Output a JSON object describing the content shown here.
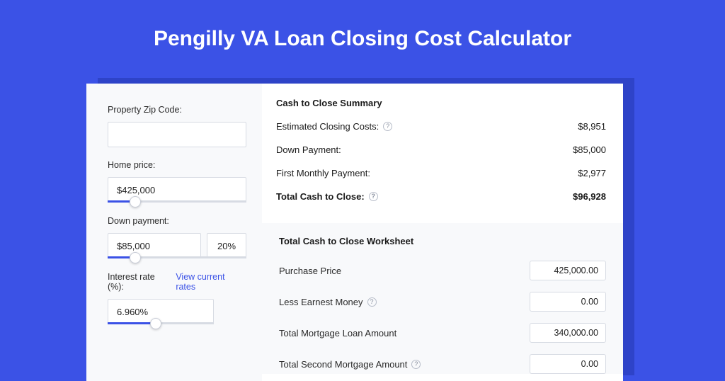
{
  "page": {
    "title": "Pengilly VA Loan Closing Cost Calculator"
  },
  "left": {
    "zip": {
      "label": "Property Zip Code:",
      "value": ""
    },
    "home_price": {
      "label": "Home price:",
      "value": "$425,000"
    },
    "down_payment": {
      "label": "Down payment:",
      "value": "$85,000",
      "pct": "20%"
    },
    "interest": {
      "label": "Interest rate (%):",
      "link": "View current rates",
      "value": "6.960%"
    }
  },
  "summary": {
    "title": "Cash to Close Summary",
    "rows": [
      {
        "label": "Estimated Closing Costs:",
        "help": true,
        "value": "$8,951"
      },
      {
        "label": "Down Payment:",
        "help": false,
        "value": "$85,000"
      },
      {
        "label": "First Monthly Payment:",
        "help": false,
        "value": "$2,977"
      }
    ],
    "total": {
      "label": "Total Cash to Close:",
      "help": true,
      "value": "$96,928"
    }
  },
  "worksheet": {
    "title": "Total Cash to Close Worksheet",
    "rows": [
      {
        "label": "Purchase Price",
        "help": false,
        "value": "425,000.00"
      },
      {
        "label": "Less Earnest Money",
        "help": true,
        "value": "0.00"
      },
      {
        "label": "Total Mortgage Loan Amount",
        "help": false,
        "value": "340,000.00"
      },
      {
        "label": "Total Second Mortgage Amount",
        "help": true,
        "value": "0.00"
      }
    ]
  }
}
